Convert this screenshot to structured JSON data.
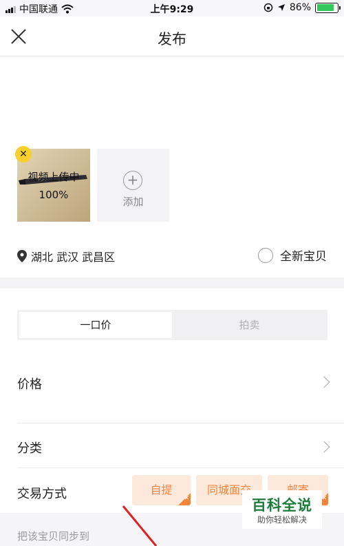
{
  "status_bar": {
    "carrier": "中国联通",
    "time": "上午9:29",
    "battery_percent": "86%",
    "battery_level": 0.86
  },
  "nav": {
    "title": "发布",
    "close_icon": "close-icon"
  },
  "media": {
    "upload_label": "视频上传中",
    "upload_progress": "100%",
    "remove_icon": "remove-icon",
    "add_label": "添加",
    "add_icon": "plus-circle-icon"
  },
  "location": {
    "icon": "location-pin-icon",
    "text": "湖北 武汉 武昌区"
  },
  "brand_new": {
    "label": "全新宝贝",
    "checked": false
  },
  "sale_mode": {
    "tabs": [
      {
        "label": "一口价",
        "active": true
      },
      {
        "label": "拍卖",
        "active": false
      }
    ]
  },
  "form": {
    "price_label": "价格",
    "category_label": "分类",
    "trade_label": "交易方式",
    "trade_options": [
      {
        "label": "自提",
        "selected": true
      },
      {
        "label": "同城面交",
        "selected": false
      },
      {
        "label": "邮寄",
        "selected": true
      }
    ],
    "sync_label": "把该宝贝同步到"
  },
  "watermark": {
    "title": "百科全说",
    "subtitle": "助你轻松解决"
  },
  "colors": {
    "accent_orange": "#f0853e",
    "chip_bg": "#fde9dc",
    "badge_yellow": "#f7d02e",
    "battery_green": "#34c759",
    "watermark_green": "#1b7d3b"
  }
}
